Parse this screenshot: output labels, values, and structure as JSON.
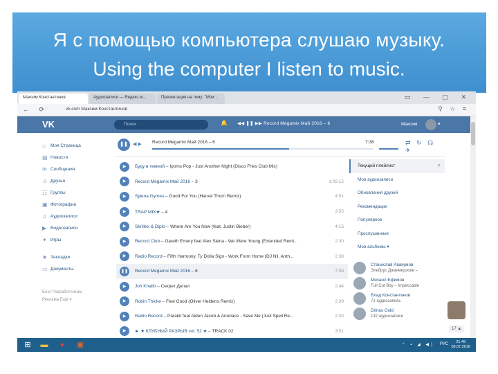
{
  "slide": {
    "title_ru": "Я с помощью компьютера слушаю музыку.",
    "title_en": "Using the computer I listen to music."
  },
  "browser": {
    "tabs": [
      "Максим Константинов",
      "Аудиозаписи — Яндекс.м...",
      "Презентация на тему: \"Мои..."
    ],
    "url": "vk.com  Максим Константинов"
  },
  "vk": {
    "search_placeholder": "Поиск",
    "header_player_title": "Record Megamix Май 2016 – 6",
    "user_name": "Максим",
    "sidebar": [
      {
        "icon": "home-icon",
        "glyph": "⌂",
        "label": "Моя Страница"
      },
      {
        "icon": "news-icon",
        "glyph": "▤",
        "label": "Новости"
      },
      {
        "icon": "messages-icon",
        "glyph": "✉",
        "label": "Сообщения"
      },
      {
        "icon": "friends-icon",
        "glyph": "☺",
        "label": "Друзья"
      },
      {
        "icon": "groups-icon",
        "glyph": "☷",
        "label": "Группы"
      },
      {
        "icon": "photos-icon",
        "glyph": "▣",
        "label": "Фотографии"
      },
      {
        "icon": "audio-icon",
        "glyph": "♫",
        "label": "Аудиозаписи"
      },
      {
        "icon": "video-icon",
        "glyph": "▶",
        "label": "Видеозаписи"
      },
      {
        "icon": "games-icon",
        "glyph": "✦",
        "label": "Игры"
      },
      {
        "icon": "bookmarks-icon",
        "glyph": "★",
        "label": "Закладки",
        "gap": true
      },
      {
        "icon": "documents-icon",
        "glyph": "▭",
        "label": "Документы"
      }
    ],
    "sidebar_footer": [
      "Блог   Разработчикам",
      "Реклама   Ещё ▾"
    ],
    "player": {
      "title": "Record Megamix Май 2016 – 6",
      "time": "7:38",
      "progress": 0.62
    },
    "tracks": [
      {
        "artist": "Буду в темной",
        "title": "Ipoms Pop - Just Another Night (Disco Fries Club Mix)",
        "duration": ""
      },
      {
        "artist": "Record Megamix Май 2016",
        "title": "3",
        "duration": "1:05:12"
      },
      {
        "artist": "Sylena Gymes",
        "title": "Good For You (Harvel Thorn Remix)",
        "duration": "4:51"
      },
      {
        "artist": "TRAP MIX★",
        "title": "4",
        "duration": "3:55"
      },
      {
        "artist": "Skrillex & Diplo",
        "title": "Where Are You Now (feat. Justin Bieber)",
        "duration": "4:15"
      },
      {
        "artist": "Record Club",
        "title": "Gareth Emery feat Alex Siena - We Were Young (Extended Remi...",
        "duration": "2:30"
      },
      {
        "artist": "Radio Record",
        "title": "Fifth Harmony, Ty Dolla Sign - Work From Home (DJ Nil, Anth...",
        "duration": "2:38"
      },
      {
        "artist": "Record Megamix Май 2016",
        "title": "6",
        "duration": "7:38",
        "current": true
      },
      {
        "artist": "Joh Khalib",
        "title": "Секрет Делал",
        "duration": "2:44"
      },
      {
        "artist": "Robin Thicke",
        "title": "Feel Good (Oliver Heldens Remix)",
        "duration": "2:39"
      },
      {
        "artist": "Radio Record",
        "title": "Parakit feat Alden Jacob & Anoriace - Save Me (Just Spell Re...",
        "duration": "2:30"
      },
      {
        "artist": "► ★ КЛУБНЫЙ РАЗРЫВ vol. 52 ★",
        "title": "TRACK 02",
        "duration": "3:51"
      }
    ],
    "right_panel": [
      {
        "label": "Текущий плейлист",
        "active": true
      },
      {
        "label": "Мои аудиозаписи"
      },
      {
        "label": "Обновления друзей"
      },
      {
        "label": "Рекомендации"
      },
      {
        "label": "Популярное"
      },
      {
        "label": "Прослушанные"
      },
      {
        "label": "Мои альбомы ▾"
      }
    ],
    "friends": [
      {
        "name": "Станислав Авакумов",
        "track": "Эльбрус Джанмирзоев –"
      },
      {
        "name": "Михаил Ефимов",
        "track": "Full Cut Boy – Impeccable"
      },
      {
        "name": "Влад Константинов",
        "track": "71 аудиозапись"
      },
      {
        "name": "Dimas Gold",
        "track": "132 аудиозаписи"
      }
    ],
    "chat_count": "17 ▲"
  },
  "taskbar": {
    "lang": "РУС",
    "time": "21:49",
    "date": "09.07.2016"
  },
  "colors": {
    "vk_header": "#4a76a8",
    "vk_accent": "#5181b8",
    "slide_blue": "#4a9ad8",
    "taskbar": "#1f5f8c"
  }
}
